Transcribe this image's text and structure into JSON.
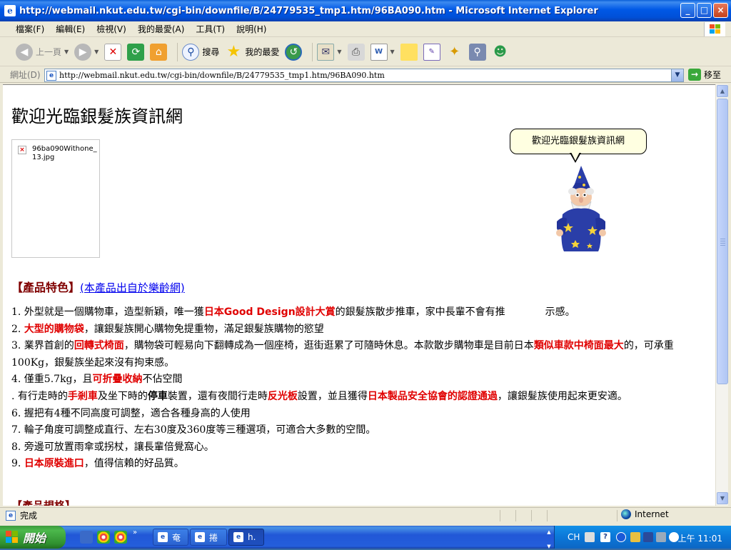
{
  "window": {
    "title": "http://webmail.nkut.edu.tw/cgi-bin/downfile/B/24779535_tmp1.htm/96BA090.htm - Microsoft Internet Explorer"
  },
  "menu": [
    "檔案(F)",
    "編輯(E)",
    "檢視(V)",
    "我的最愛(A)",
    "工具(T)",
    "說明(H)"
  ],
  "toolbar": {
    "back": "上一頁",
    "search": "搜尋",
    "favorites": "我的最愛"
  },
  "address": {
    "label": "網址(D)",
    "url": "http://webmail.nkut.edu.tw/cgi-bin/downfile/B/24779535_tmp1.htm/96BA090.htm",
    "go": "移至"
  },
  "page": {
    "title": "歡迎光臨銀髮族資訊網",
    "image_alt": "96ba090Withone_13.jpg",
    "section_head": "【產品特色】",
    "section_link": "(本產品出自於樂齡網)",
    "items": [
      [
        {
          "t": "1. 外型就是一個購物車，造型新穎，唯一獲"
        },
        {
          "t": "日本Good Design設計大賞",
          "c": "red"
        },
        {
          "t": "的銀髮族散步推車，家中長輩不會有推"
        },
        {
          "t": "　　　　",
          "c": "gap"
        },
        {
          "t": "示感。"
        }
      ],
      [
        {
          "t": "2. "
        },
        {
          "t": "大型的購物袋",
          "c": "red"
        },
        {
          "t": "，讓銀髮族開心購物免提重物，滿足銀髮族購物的慾望"
        }
      ],
      [
        {
          "t": "3. 業界首創的"
        },
        {
          "t": "回轉式椅面",
          "c": "red"
        },
        {
          "t": "，購物袋可輕易向下翻轉成為一個座椅，逛街逛累了可隨時休息。本款散步購物車是目前日本"
        },
        {
          "t": "類似車款中椅面最大",
          "c": "red"
        },
        {
          "t": "的，可承重100Kg，銀髮族坐起來沒有拘束感。"
        }
      ],
      [
        {
          "t": "4. 僅重5.7kg，且"
        },
        {
          "t": "可折疊收納",
          "c": "red"
        },
        {
          "t": "不佔空間"
        }
      ],
      [
        {
          "t": ". 有行走時的"
        },
        {
          "t": "手剎車",
          "c": "red"
        },
        {
          "t": "及坐下時的"
        },
        {
          "t": "停車",
          "c": "blk"
        },
        {
          "t": "裝置，還有夜間行走時"
        },
        {
          "t": "反光板",
          "c": "red"
        },
        {
          "t": "設置，並且獲得"
        },
        {
          "t": "日本製品安全協會的認證通過",
          "c": "red"
        },
        {
          "t": "，讓銀髮族使用起來更安適。"
        }
      ],
      [
        {
          "t": "6. 握把有4種不同高度可調整，適合各種身高的人使用"
        }
      ],
      [
        {
          "t": "7. 輪子角度可調整成直行、左右30度及360度等三種選項，可適合大多數的空間。"
        }
      ],
      [
        {
          "t": "8. 旁邊可放置雨傘或拐杖，讓長輩倍覺窩心。"
        }
      ],
      [
        {
          "t": "9. "
        },
        {
          "t": "日本原裝進口",
          "c": "red"
        },
        {
          "t": "，值得信賴的好品質。"
        }
      ]
    ],
    "cut_head": "【產品規格】"
  },
  "agent": {
    "balloon": "歡迎光臨銀髮族資訊網"
  },
  "status": {
    "text": "完成",
    "zone": "Internet"
  },
  "taskbar": {
    "start": "開始",
    "buttons": [
      "奄",
      "捲",
      "h."
    ],
    "lang": "CH",
    "clock": "上午 11:01"
  },
  "colors": {
    "title_bar": "#0058e6",
    "highlight_red": "#e00000",
    "section_red": "#800000",
    "link_blue": "#0000ee"
  }
}
